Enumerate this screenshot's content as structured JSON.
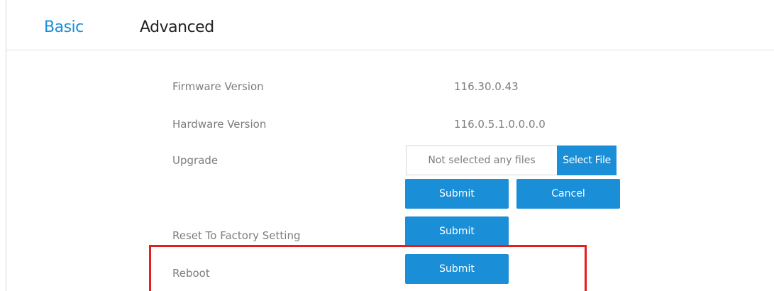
{
  "tabs": {
    "basic": "Basic",
    "advanced": "Advanced"
  },
  "rows": {
    "firmware": {
      "label": "Firmware Version",
      "value": "116.30.0.43"
    },
    "hardware": {
      "label": "Hardware Version",
      "value": "116.0.5.1.0.0.0.0"
    },
    "upgrade": {
      "label": "Upgrade",
      "file_placeholder": "Not selected any files",
      "select_file_label": "Select File",
      "submit_label": "Submit",
      "cancel_label": "Cancel"
    },
    "reset": {
      "label": "Reset To Factory Setting",
      "submit_label": "Submit"
    },
    "reboot": {
      "label": "Reboot",
      "submit_label": "Submit"
    }
  },
  "colors": {
    "accent": "#1a8fd8",
    "highlight": "#e51d1d",
    "muted_text": "#7d7d7d"
  }
}
